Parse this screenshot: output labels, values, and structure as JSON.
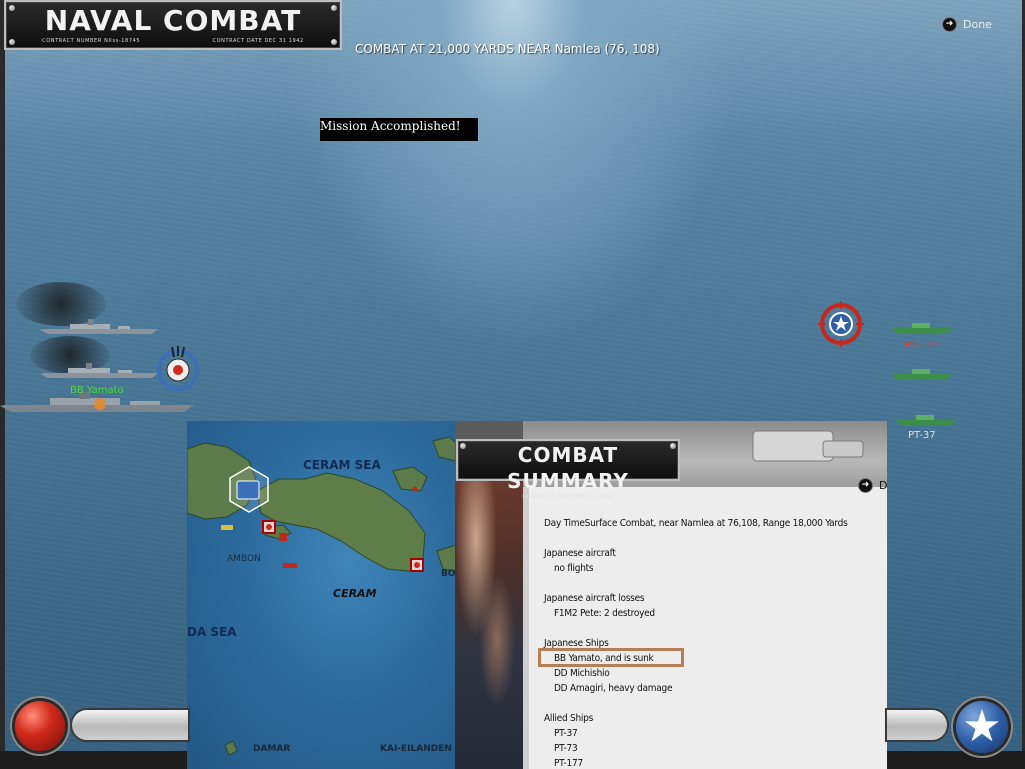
{
  "header": {
    "title": "NAVAL COMBAT",
    "contract_number": "CONTRACT NUMBER   NXss-18745",
    "contract_date": "CONTRACT DATE DEC 31 1942",
    "headline": "COMBAT AT 21,000 YARDS NEAR Namlea (76, 108)",
    "done_label": "Done"
  },
  "banner": {
    "mission": "Mission Accomplished!"
  },
  "ships": {
    "japanese_label": "BB Yamato",
    "allied": [
      {
        "label": "PT-177",
        "color": "#e23b2e"
      },
      {
        "label": "PT-73",
        "color": "#e0e0e0"
      },
      {
        "label": "PT-37",
        "color": "#e0e0e0"
      }
    ]
  },
  "map": {
    "labels": {
      "ceram_sea": "CERAM SEA",
      "ambon": "AMBON",
      "ceram": "CERAM",
      "banda_sea": "DA SEA",
      "damar": "DAMAR",
      "kai": "KAI-EILANDEN",
      "bo": "BO"
    }
  },
  "summary": {
    "plate_title": "COMBAT SUMMARY",
    "plate_date": "CONTRACT DATE DEC 31 1942",
    "done_label": "D",
    "lines": [
      {
        "text": "Day TimeSurface Combat, near Namlea at 76,108, Range 18,000 Yards",
        "indent": false
      },
      {
        "text": "",
        "gap": true
      },
      {
        "text": "Japanese aircraft",
        "indent": false
      },
      {
        "text": "no flights",
        "indent": true
      },
      {
        "text": "",
        "gap": true
      },
      {
        "text": "Japanese aircraft losses",
        "indent": false
      },
      {
        "text": "F1M2 Pete: 2 destroyed",
        "indent": true
      },
      {
        "text": "",
        "gap": true
      },
      {
        "text": "Japanese Ships",
        "indent": false
      },
      {
        "text": "BB Yamato, and is sunk",
        "indent": true
      },
      {
        "text": "DD Michishio",
        "indent": true
      },
      {
        "text": "DD Amagiri, heavy damage",
        "indent": true
      },
      {
        "text": "",
        "gap": true
      },
      {
        "text": "Allied Ships",
        "indent": false
      },
      {
        "text": "PT-37",
        "indent": true
      },
      {
        "text": "PT-73",
        "indent": true
      },
      {
        "text": "PT-177",
        "indent": true
      }
    ]
  },
  "colors": {
    "sea": "#4a7898",
    "japanese_label": "#4ddc3a",
    "highlight": "#b97d55",
    "red_button": "#d0291b",
    "star_button": "#2f5fa8"
  },
  "icons": {
    "done": "arrow-right-circle-icon",
    "target_japanese": "crosshair-rising-sun-icon",
    "target_allied": "crosshair-us-star-icon",
    "end_turn": "us-star-icon"
  }
}
